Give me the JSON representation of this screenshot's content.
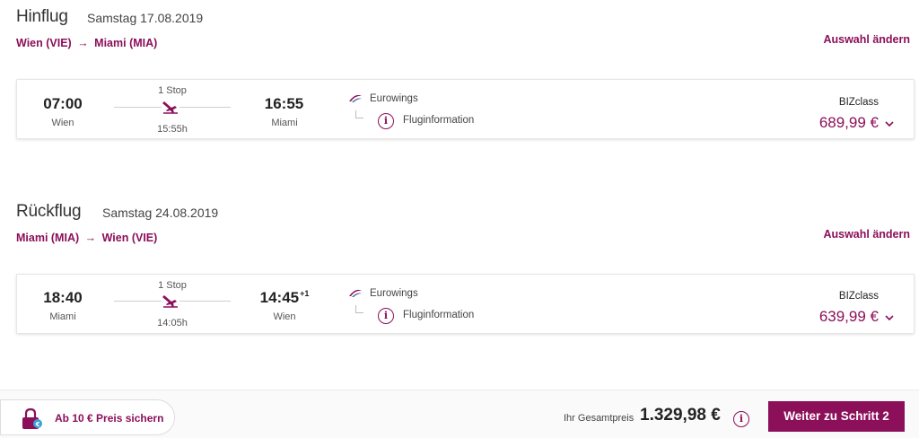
{
  "outbound": {
    "title": "Hinflug",
    "date": "Samstag 17.08.2019",
    "from": "Wien (VIE)",
    "arrow": "→",
    "to": "Miami (MIA)",
    "change_label": "Auswahl ändern",
    "dep_time": "07:00",
    "dep_city": "Wien",
    "stops": "1 Stop",
    "duration": "15:55h",
    "arr_time": "16:55",
    "arr_day_offset": "",
    "arr_city": "Miami",
    "airline": "Eurowings",
    "info_label": "Fluginformation",
    "class": "BIZclass",
    "price": "689,99 €"
  },
  "return": {
    "title": "Rückflug",
    "date": "Samstag 24.08.2019",
    "from": "Miami (MIA)",
    "arrow": "→",
    "to": "Wien (VIE)",
    "change_label": "Auswahl ändern",
    "dep_time": "18:40",
    "dep_city": "Miami",
    "stops": "1 Stop",
    "duration": "14:05h",
    "arr_time": "14:45",
    "arr_day_offset": "+1",
    "arr_city": "Wien",
    "airline": "Eurowings",
    "info_label": "Fluginformation",
    "class": "BIZclass",
    "price": "639,99 €"
  },
  "footer": {
    "secure_label": "Ab 10 € Preis sichern",
    "total_label": "Ihr Gesamtpreis",
    "total": "1.329,98 €",
    "next_label": "Weiter zu Schritt 2"
  },
  "colors": {
    "accent": "#8c0f5a",
    "text": "#333333"
  },
  "icons": {
    "plane": "plane-descending-icon",
    "airline": "eurowings-logo-icon",
    "info": "info-icon",
    "chevron": "chevron-down-icon",
    "lock": "lock-icon"
  }
}
